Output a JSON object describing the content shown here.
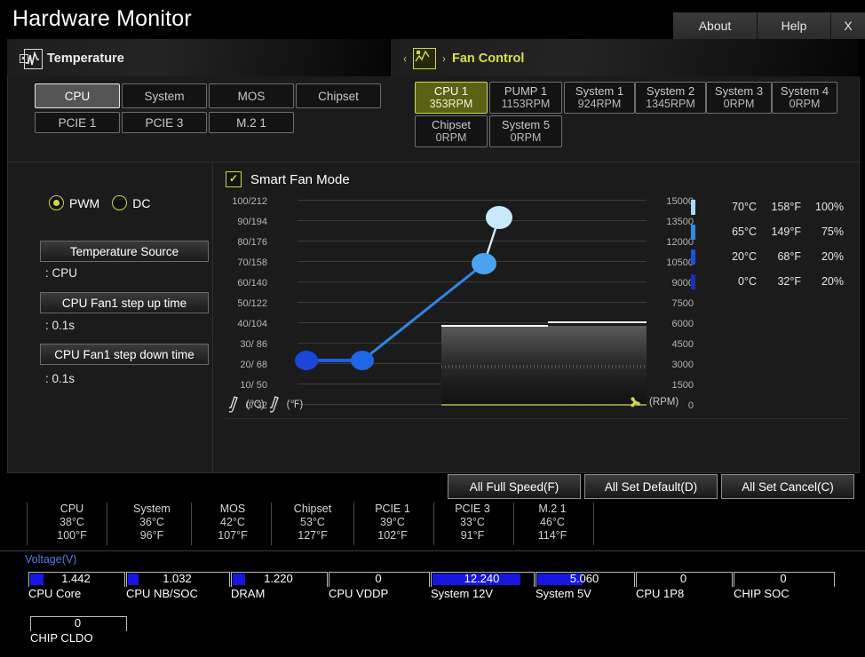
{
  "window": {
    "title": "Hardware Monitor",
    "buttons": [
      {
        "label": "About",
        "name": "about-button"
      },
      {
        "label": "Help",
        "name": "help-button"
      },
      {
        "label": "X",
        "name": "close-button"
      }
    ]
  },
  "tabs": [
    {
      "label": "Temperature",
      "active": false
    },
    {
      "label": "Fan Control",
      "active": true
    }
  ],
  "tab_nav": {
    "prev": "‹",
    "next": "›"
  },
  "temp_sources": [
    {
      "label": "CPU",
      "active": true
    },
    {
      "label": "System",
      "active": false
    },
    {
      "label": "MOS",
      "active": false
    },
    {
      "label": "Chipset",
      "active": false
    },
    {
      "label": "PCIE 1",
      "active": false
    },
    {
      "label": "PCIE 3",
      "active": false
    },
    {
      "label": "M.2 1",
      "active": false
    }
  ],
  "fans": [
    {
      "name": "CPU 1",
      "rpm": "353RPM",
      "active": true
    },
    {
      "name": "PUMP 1",
      "rpm": "1153RPM",
      "active": false
    },
    {
      "name": "System 1",
      "rpm": "924RPM",
      "active": false
    },
    {
      "name": "System 2",
      "rpm": "1345RPM",
      "active": false
    },
    {
      "name": "System 3",
      "rpm": "0RPM",
      "active": false
    },
    {
      "name": "System 4",
      "rpm": "0RPM",
      "active": false
    },
    {
      "name": "Chipset",
      "rpm": "0RPM",
      "active": false
    },
    {
      "name": "System 5",
      "rpm": "0RPM",
      "active": false
    }
  ],
  "controls": {
    "pwm_label": "PWM",
    "dc_label": "DC",
    "pwm_selected": true,
    "fields": [
      {
        "label": "Temperature Source",
        "value": ": CPU"
      },
      {
        "label": "CPU Fan1 step up time",
        "value": ": 0.1s"
      },
      {
        "label": "CPU Fan1 step down time",
        "value": ": 0.1s"
      }
    ]
  },
  "smart_fan": {
    "label": "Smart Fan Mode",
    "checked": true,
    "check_glyph": "✓"
  },
  "chart_data": {
    "type": "line",
    "title": "Smart Fan Mode fan curve",
    "xlabel": "",
    "ylabel": "Temperature (°C / °F)",
    "y2label": "RPM",
    "ytick_labels": [
      "100/212",
      "90/194",
      "80/176",
      "70/158",
      "60/140",
      "50/122",
      "40/104",
      "30/ 86",
      "20/ 68",
      "10/ 50",
      "0/ 32"
    ],
    "ytick_values_c": [
      100,
      90,
      80,
      70,
      60,
      50,
      40,
      30,
      20,
      10,
      0
    ],
    "ytick_values_f": [
      212,
      194,
      176,
      158,
      140,
      122,
      104,
      86,
      68,
      50,
      32
    ],
    "ylim": [
      0,
      100
    ],
    "y2tick_labels": [
      "15000",
      "13500",
      "12000",
      "10500",
      "9000",
      "7500",
      "6000",
      "4500",
      "3000",
      "1500",
      "0"
    ],
    "y2lim": [
      0,
      15000
    ],
    "grid": true,
    "points": [
      {
        "temp_c": 0,
        "temp_f": 32,
        "duty": 20,
        "color": "#1a47d8"
      },
      {
        "temp_c": 20,
        "temp_f": 68,
        "duty": 20,
        "color": "#1f66e8"
      },
      {
        "temp_c": 65,
        "temp_f": 149,
        "duty": 75,
        "color": "#4aa3f0"
      },
      {
        "temp_c": 70,
        "temp_f": 158,
        "duty": 100,
        "color": "#c8e8fb"
      }
    ],
    "legend_position": "right",
    "legend": [
      {
        "temp_c": "70°C",
        "temp_f": "158°F",
        "duty": "100%",
        "color": "#a9d9f5"
      },
      {
        "temp_c": "65°C",
        "temp_f": "149°F",
        "duty": "75%",
        "color": "#2f8ae8"
      },
      {
        "temp_c": "20°C",
        "temp_f": "68°F",
        "duty": "20%",
        "color": "#1c50e6"
      },
      {
        "temp_c": "0°C",
        "temp_f": "32°F",
        "duty": "20%",
        "color": "#1531c2"
      }
    ],
    "axis_icons": {
      "celsius": "(℃)",
      "fahrenheit": "(℉)",
      "rpm": "(RPM)"
    }
  },
  "action_buttons": [
    {
      "label": "All Full Speed(F)"
    },
    {
      "label": "All Set Default(D)"
    },
    {
      "label": "All Set Cancel(C)"
    }
  ],
  "temperatures": [
    {
      "name": "CPU",
      "c": "38°C",
      "f": "100°F"
    },
    {
      "name": "System",
      "c": "36°C",
      "f": "96°F"
    },
    {
      "name": "MOS",
      "c": "42°C",
      "f": "107°F"
    },
    {
      "name": "Chipset",
      "c": "53°C",
      "f": "127°F"
    },
    {
      "name": "PCIE 1",
      "c": "39°C",
      "f": "102°F"
    },
    {
      "name": "PCIE 3",
      "c": "33°C",
      "f": "91°F"
    },
    {
      "name": "M.2 1",
      "c": "46°C",
      "f": "114°F"
    }
  ],
  "voltage": {
    "title": "Voltage(V)",
    "items": [
      {
        "name": "CPU Core",
        "value": "1.442",
        "fill": 14
      },
      {
        "name": "CPU NB/SOC",
        "value": "1.032",
        "fill": 11
      },
      {
        "name": "DRAM",
        "value": "1.220",
        "fill": 13
      },
      {
        "name": "CPU VDDP",
        "value": "0",
        "fill": 0
      },
      {
        "name": "System 12V",
        "value": "12.240",
        "fill": 78
      },
      {
        "name": "System 5V",
        "value": "5.060",
        "fill": 48
      },
      {
        "name": "CPU 1P8",
        "value": "0",
        "fill": 0
      },
      {
        "name": "CHIP SOC",
        "value": "0",
        "fill": 0
      },
      {
        "name": "CHIP CLDO",
        "value": "0",
        "fill": 0
      }
    ],
    "bar_color": "#1616e0"
  }
}
